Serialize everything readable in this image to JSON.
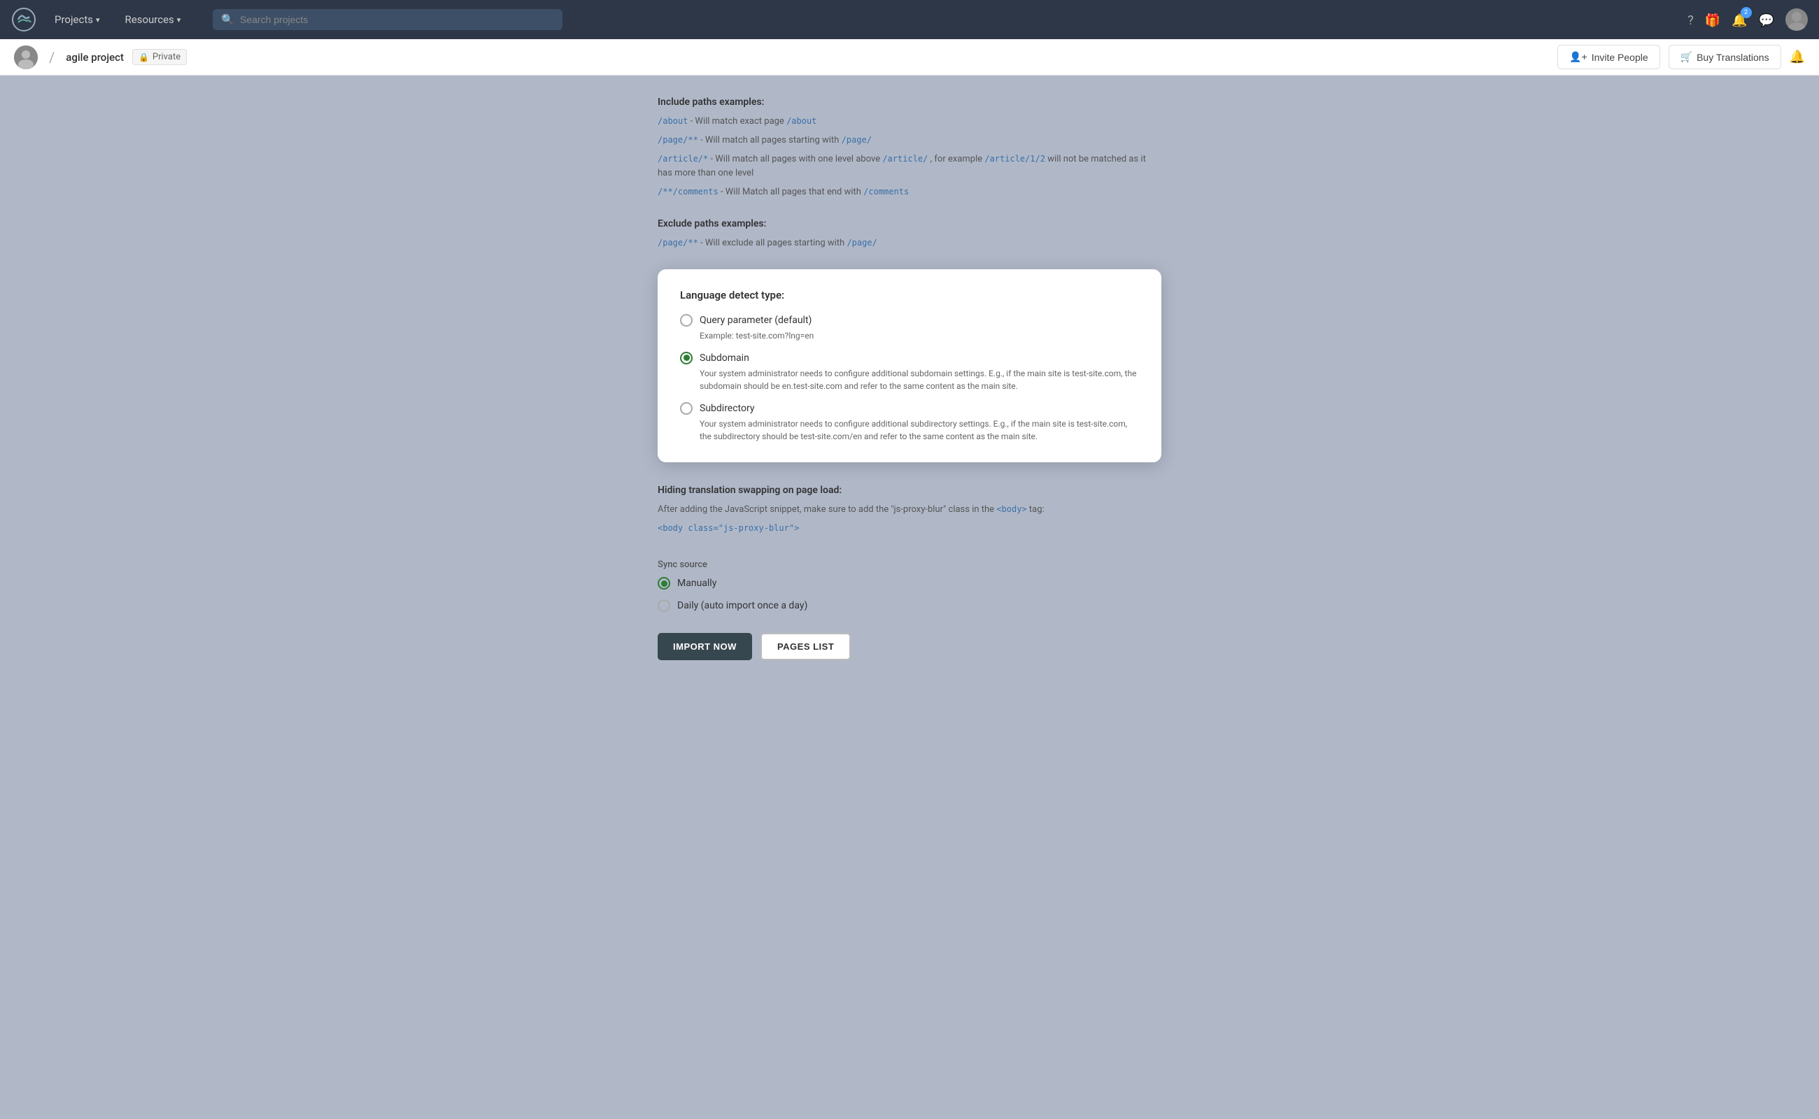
{
  "topNav": {
    "logo_alt": "Crowdin logo",
    "projects_label": "Projects",
    "resources_label": "Resources",
    "search_placeholder": "Search projects",
    "notifications_count": "2",
    "help_icon": "?",
    "gift_icon": "🎁",
    "bell_icon": "🔔",
    "chat_icon": "💬"
  },
  "subNav": {
    "project_name": "agile project",
    "private_label": "Private",
    "invite_label": "Invite People",
    "buy_label": "Buy Translations"
  },
  "page": {
    "include_paths_title": "Include paths examples:",
    "include_line1_code1": "/about",
    "include_line1_text": " - Will match exact page ",
    "include_line1_code2": "/about",
    "include_line2_code1": "/page/**",
    "include_line2_text": " - Will match all pages starting with ",
    "include_line2_code2": "/page/",
    "include_line3_code1": "/article/*",
    "include_line3_text": " - Will match all pages with one level above ",
    "include_line3_code2": "/article/",
    "include_line3_text2": ", for example ",
    "include_line3_code3": "/article/1/2",
    "include_line3_text3": " will not be matched as it has more than one level",
    "include_line4_code1": "/**/comments",
    "include_line4_text": " - Will Match all pages that end with ",
    "include_line4_code2": "/comments",
    "exclude_paths_title": "Exclude paths examples:",
    "exclude_line1_code1": "/page/**",
    "exclude_line1_text": " - Will exclude all pages starting with ",
    "exclude_line1_code2": "/page/",
    "modal": {
      "title": "Language detect type:",
      "option1_label": "Query parameter (default)",
      "option1_example": "Example: test-site.com?lng=en",
      "option1_selected": false,
      "option2_label": "Subdomain",
      "option2_desc": "Your system administrator needs to configure additional subdomain settings. E.g., if the main site is test-site.com, the subdomain should be en.test-site.com and refer to the same content as the main site.",
      "option2_selected": true,
      "option3_label": "Subdirectory",
      "option3_desc": "Your system administrator needs to configure additional subdirectory settings. E.g., if the main site is test-site.com, the subdirectory should be test-site.com/en and refer to the same content as the main site.",
      "option3_selected": false
    },
    "hiding_title": "Hiding translation swapping on page load:",
    "hiding_text1": "After adding the JavaScript snippet, make sure to add the \"js-proxy-blur\" class in the ",
    "hiding_code1": "<body>",
    "hiding_text2": " tag:",
    "hiding_code2": "<body class=\"js-proxy-blur\">",
    "sync_title": "Sync source",
    "sync_manually_label": "Manually",
    "sync_manually_selected": true,
    "sync_daily_label": "Daily (auto import once a day)",
    "sync_daily_selected": false,
    "import_btn": "IMPORT NOW",
    "pages_btn": "PAGES LIST"
  }
}
